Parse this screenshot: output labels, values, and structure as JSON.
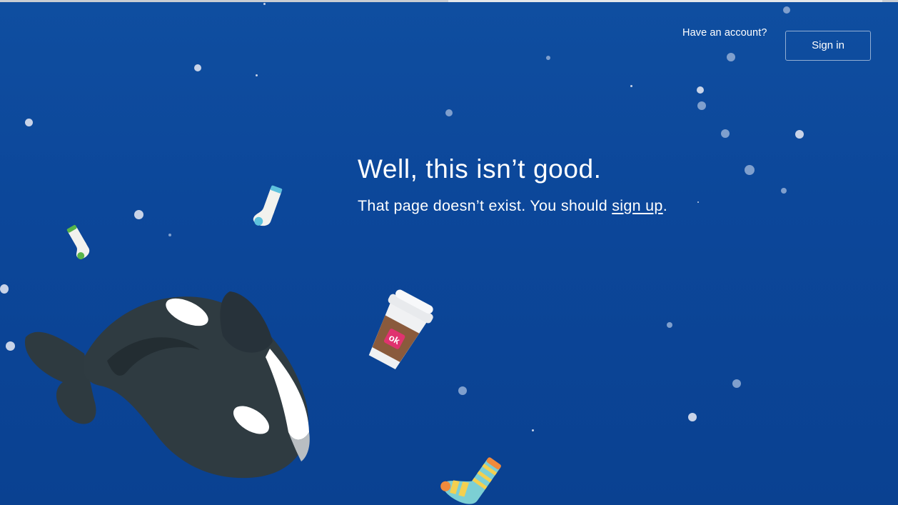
{
  "header": {
    "account_prompt": "Have an account?",
    "signin_label": "Sign in"
  },
  "error": {
    "headline": "Well, this isn’t good.",
    "message_prefix": "That page doesn’t exist. You should ",
    "signup_link": "sign up",
    "message_suffix": "."
  },
  "cup_logo_text": "ok",
  "colors": {
    "background_top": "#0f4ea0",
    "background_bottom": "#0a4191",
    "whale_body": "#2e3a40",
    "whale_patch": "#ffffff",
    "cup_sleeve": "#8a5a3c",
    "cup_logo": "#e0336f"
  },
  "illustrations": [
    "whale-icon",
    "coffee-cup-icon",
    "teal-sock-icon",
    "green-sock-icon",
    "striped-sock-icon",
    "bubbles"
  ]
}
